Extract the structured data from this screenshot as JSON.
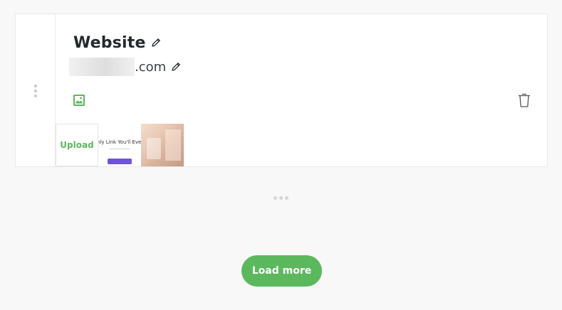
{
  "link_card": {
    "title": "Website",
    "url_suffix": ".com",
    "upload_label": "Upload",
    "thumbnail_1_text": "nly Link You'll Ever",
    "accent_color": "#5cb85c"
  },
  "icons": {
    "drag": "drag-handle-icon",
    "edit_title": "pencil-icon",
    "edit_url": "pencil-icon",
    "image": "image-icon",
    "delete": "trash-icon"
  },
  "load_more": {
    "label": "Load more",
    "color": "#5cb85c"
  }
}
